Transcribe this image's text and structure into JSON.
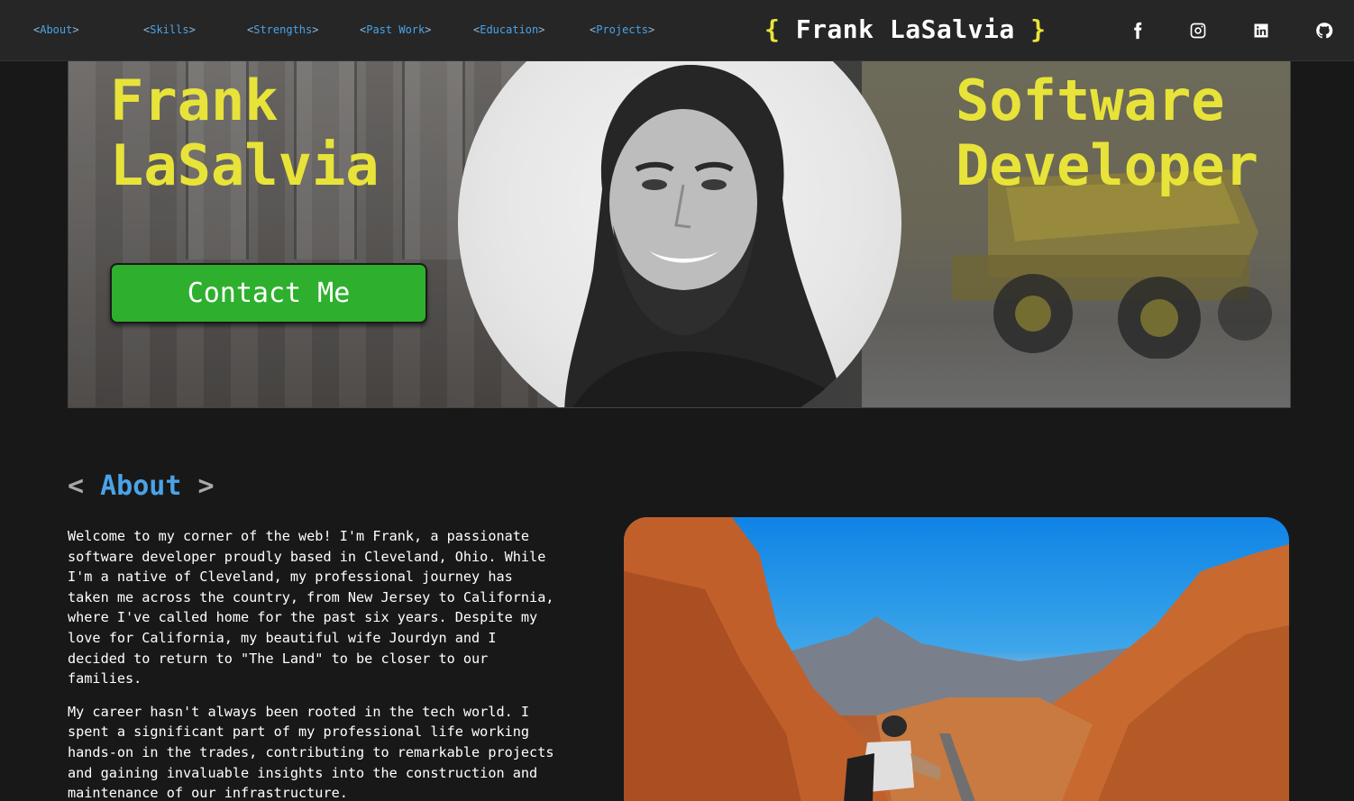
{
  "nav": {
    "links": [
      {
        "text": "About"
      },
      {
        "text": "Skills"
      },
      {
        "text": "Strengths"
      },
      {
        "text": "Past Work"
      },
      {
        "text": "Education"
      },
      {
        "text": "Projects"
      }
    ],
    "brand": {
      "open": "{",
      "name": "Frank LaSalvia",
      "close": "}"
    },
    "social": [
      "facebook-icon",
      "instagram-icon",
      "linkedin-icon",
      "github-icon"
    ]
  },
  "hero": {
    "name_line1": "Frank",
    "name_line2": "LaSalvia",
    "title_line1": "Software",
    "title_line2": "Developer",
    "contact_label": "Contact Me"
  },
  "about": {
    "open": "<",
    "heading": "About",
    "close": ">",
    "paragraphs": [
      "Welcome to my corner of the web! I'm Frank, a passionate software developer proudly based in Cleveland, Ohio. While I'm a native of Cleveland, my professional journey has taken me across the country, from New Jersey to California, where I've called home for the past six years. Despite my love for California, my beautiful wife Jourdyn and I decided to return to \"The Land\" to be closer to our families.",
      "My career hasn't always been rooted in the tech world. I spent a significant part of my professional life working hands-on in the trades, contributing to remarkable projects and gaining invaluable insights into the construction and maintenance of our infrastructure."
    ]
  },
  "colors": {
    "accent_yellow": "#e8e339",
    "link_blue": "#4aa3e8",
    "button_green": "#2eb02e",
    "background": "#181818",
    "nav_bg": "#262626"
  }
}
